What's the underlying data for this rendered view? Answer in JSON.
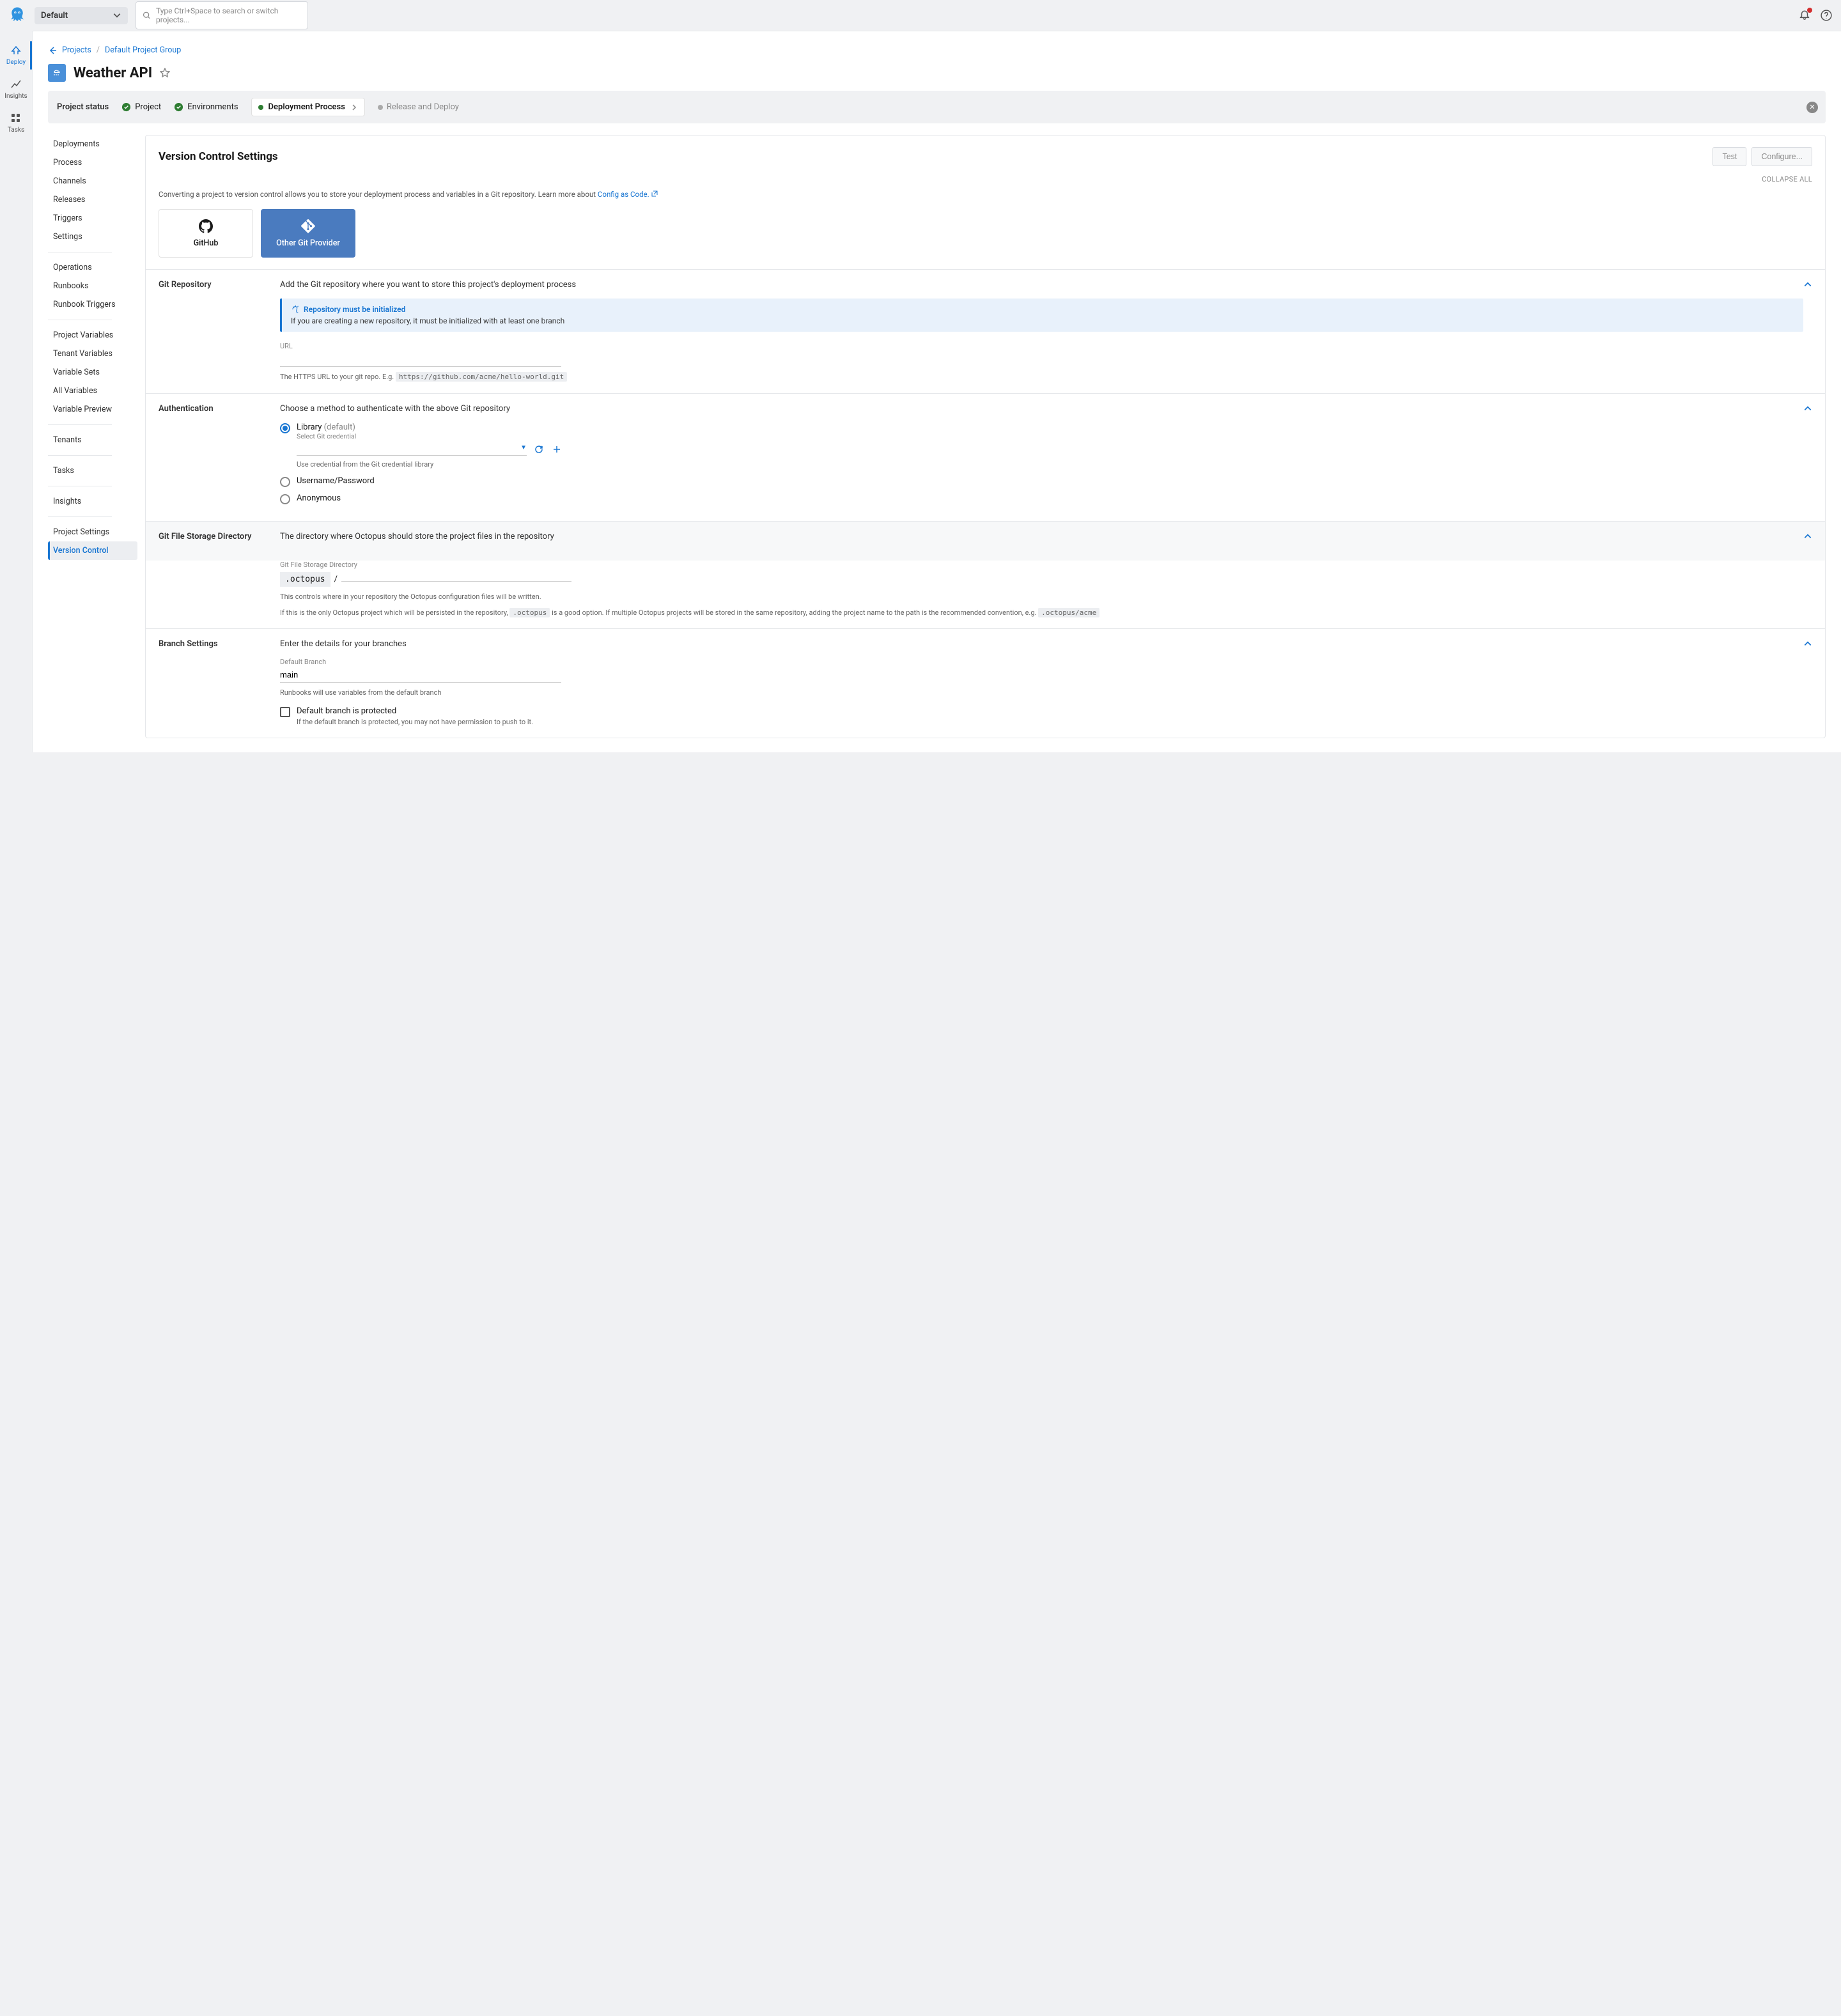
{
  "topbar": {
    "space": "Default",
    "search_placeholder": "Type Ctrl+Space to search or switch projects..."
  },
  "sidebar": {
    "items": [
      {
        "label": "Deploy"
      },
      {
        "label": "Insights"
      },
      {
        "label": "Tasks"
      }
    ]
  },
  "breadcrumb": {
    "projects": "Projects",
    "group": "Default Project Group"
  },
  "title": "Weather API",
  "status": {
    "label": "Project status",
    "items": {
      "project": "Project",
      "environments": "Environments",
      "deployment": "Deployment Process",
      "release": "Release and Deploy"
    }
  },
  "leftnav": {
    "deployments": "Deployments",
    "process": "Process",
    "channels": "Channels",
    "releases": "Releases",
    "triggers": "Triggers",
    "settings": "Settings",
    "operations": "Operations",
    "runbooks": "Runbooks",
    "runbook_triggers": "Runbook Triggers",
    "project_variables": "Project Variables",
    "tenant_variables": "Tenant Variables",
    "variable_sets": "Variable Sets",
    "all_variables": "All Variables",
    "variable_preview": "Variable Preview",
    "tenants": "Tenants",
    "tasks": "Tasks",
    "insights": "Insights",
    "project_settings": "Project Settings",
    "version_control": "Version Control"
  },
  "panel": {
    "title": "Version Control Settings",
    "test": "Test",
    "configure": "Configure...",
    "collapse": "COLLAPSE ALL",
    "desc": "Converting a project to version control allows you to store your deployment process and variables in a Git repository. Learn more about ",
    "desc_link": "Config as Code.",
    "providers": {
      "github": "GitHub",
      "other": "Other Git Provider"
    }
  },
  "git_repo": {
    "heading": "Git Repository",
    "desc": "Add the Git repository where you want to store this project's deployment process",
    "callout_title": "Repository must be initialized",
    "callout_body": "If you are creating a new repository, it must be initialized with at least one branch",
    "url_label": "URL",
    "url_help": "The HTTPS URL to your git repo. E.g. ",
    "url_example": "https://github.com/acme/hello-world.git"
  },
  "auth": {
    "heading": "Authentication",
    "desc": "Choose a method to authenticate with the above Git repository",
    "library": "Library",
    "default": " (default)",
    "select_cred": "Select Git credential",
    "cred_help": "Use credential from the Git credential library",
    "userpass": "Username/Password",
    "anonymous": "Anonymous"
  },
  "storage": {
    "heading": "Git File Storage Directory",
    "desc": "The directory where Octopus should store the project files in the repository",
    "label": "Git File Storage Directory",
    "value": ".octopus",
    "help1": "This controls where in your repository the Octopus configuration files will be written.",
    "help2a": "If this is the only Octopus project which will be persisted in the repository, ",
    "help2_code1": ".octopus",
    "help2b": " is a good option. If multiple Octopus projects will be stored in the same repository, adding the project name to the path is the recommended convention, e.g. ",
    "help2_code2": ".octopus/acme"
  },
  "branch": {
    "heading": "Branch Settings",
    "desc": "Enter the details for your branches",
    "label": "Default Branch",
    "value": "main",
    "help": "Runbooks will use variables from the default branch",
    "protected": "Default branch is protected",
    "protected_help": "If the default branch is protected, you may not have permission to push to it."
  }
}
